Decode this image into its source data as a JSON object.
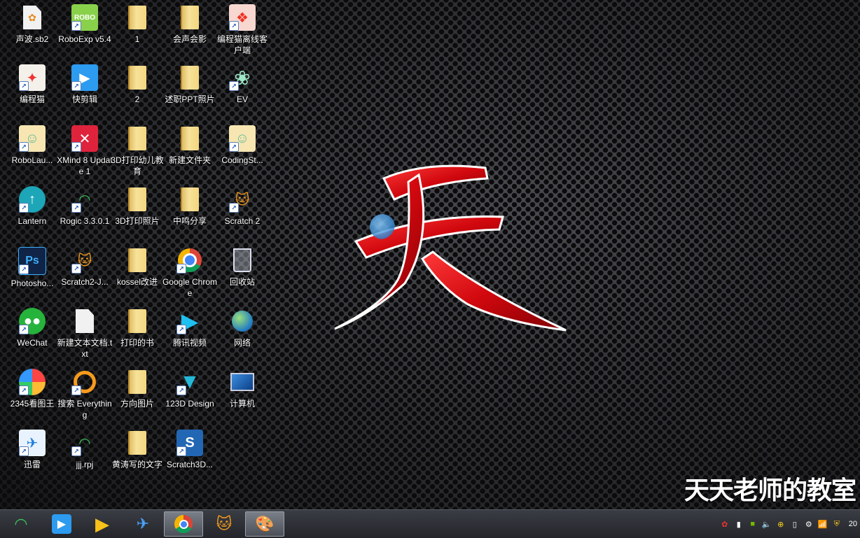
{
  "desktop": {
    "icons": [
      {
        "label": "声波.sb2"
      },
      {
        "label": "RoboExp v5.4"
      },
      {
        "label": "1"
      },
      {
        "label": "会声会影"
      },
      {
        "label": "编程猫离线客户端"
      },
      {
        "label": "编程猫"
      },
      {
        "label": "快剪辑"
      },
      {
        "label": "2"
      },
      {
        "label": "述职PPT照片"
      },
      {
        "label": "EV"
      },
      {
        "label": "RoboLau..."
      },
      {
        "label": "XMind 8 Update 1"
      },
      {
        "label": "3D打印幼儿教育"
      },
      {
        "label": "新建文件夹"
      },
      {
        "label": "CodingSt..."
      },
      {
        "label": "Lantern"
      },
      {
        "label": "Rogic 3.3.0.1"
      },
      {
        "label": "3D打印照片"
      },
      {
        "label": "中鸣分享"
      },
      {
        "label": "Scratch 2"
      },
      {
        "label": "Photosho..."
      },
      {
        "label": "Scratch2-J..."
      },
      {
        "label": "kossel改进"
      },
      {
        "label": "Google Chrome"
      },
      {
        "label": "回收站"
      },
      {
        "label": "WeChat"
      },
      {
        "label": "新建文本文档.txt"
      },
      {
        "label": "打印的书"
      },
      {
        "label": "腾讯视频"
      },
      {
        "label": "网络"
      },
      {
        "label": "2345看图王"
      },
      {
        "label": "搜索 Everything"
      },
      {
        "label": "方向图片"
      },
      {
        "label": "123D Design"
      },
      {
        "label": "计算机"
      },
      {
        "label": "迅雷"
      },
      {
        "label": "jjj.rpj"
      },
      {
        "label": "黄涛写的文字"
      },
      {
        "label": "Scratch3D..."
      }
    ]
  },
  "wallpaper": {
    "character": "天"
  },
  "watermark": {
    "text": "天天老师的教室"
  },
  "clock": {
    "text": "20"
  },
  "colors": {
    "accent_red": "#d8141a",
    "taskbar": "#2c2f35"
  }
}
